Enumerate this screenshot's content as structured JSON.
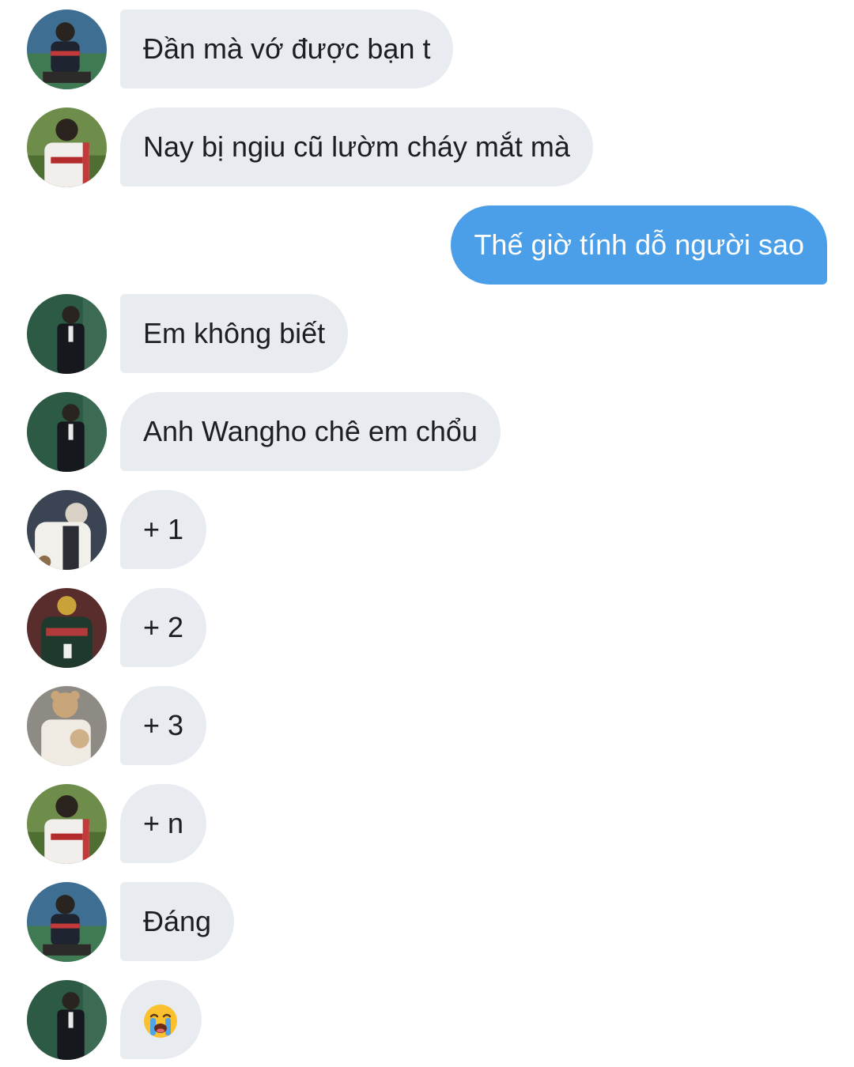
{
  "messages": [
    {
      "sender": "received",
      "avatar": "boy-sports-jersey-avatar",
      "text": "Đần mà vớ được bạn t"
    },
    {
      "sender": "received",
      "avatar": "boy-landers-jersey-avatar",
      "text": "Nay bị ngiu cũ lườm cháy mắt mà"
    },
    {
      "sender": "sent",
      "text": "Thế giờ tính dỗ người sao"
    },
    {
      "sender": "received",
      "avatar": "boy-black-suit-avatar",
      "text": "Em không biết"
    },
    {
      "sender": "received",
      "avatar": "boy-black-suit-avatar",
      "text": "Anh Wangho chê em chổu"
    },
    {
      "sender": "received",
      "avatar": "boy-fleece-jacket-avatar",
      "text": "+ 1"
    },
    {
      "sender": "received",
      "avatar": "boy-varsity-jacket-avatar",
      "text": "+ 2"
    },
    {
      "sender": "received",
      "avatar": "boy-bear-hat-avatar",
      "text": "+ 3"
    },
    {
      "sender": "received",
      "avatar": "boy-landers-jersey-avatar",
      "text": "+ n"
    },
    {
      "sender": "received",
      "avatar": "boy-sports-jersey-avatar",
      "text": "Đáng"
    },
    {
      "sender": "received",
      "avatar": "boy-black-suit-avatar",
      "emoji": "loudly-crying-face-icon"
    }
  ],
  "colors": {
    "received_bubble": "#e8ebef",
    "sent_bubble": "#4b9fe8",
    "text": "#1c1e21"
  }
}
